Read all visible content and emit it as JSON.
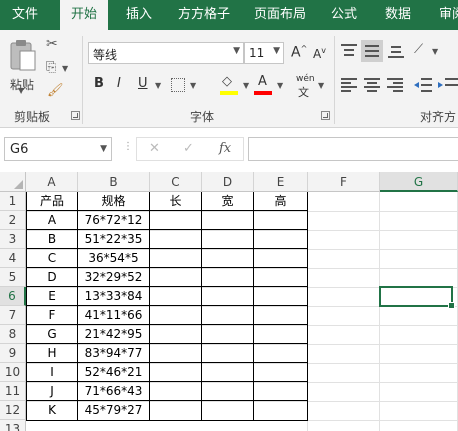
{
  "ribbon_tabs": [
    "文件",
    "开始",
    "插入",
    "方方格子",
    "页面布局",
    "公式",
    "数据",
    "审阅"
  ],
  "active_tab": "开始",
  "clipboard": {
    "paste_label": "粘贴",
    "group_label": "剪贴板"
  },
  "font": {
    "name": "等线",
    "size": "11",
    "group_label": "字体",
    "bold": "B",
    "italic": "I",
    "underline": "U",
    "grow": "A",
    "shrink": "A",
    "phonetic": "wén",
    "font_color_letter": "A",
    "highlight_color": "#ffff00",
    "font_color": "#ff0000"
  },
  "alignment": {
    "group_label": "对齐方"
  },
  "formula_bar": {
    "name_box": "G6",
    "cancel": "✕",
    "enter": "✓",
    "fx": "fx",
    "formula": ""
  },
  "columns": [
    "A",
    "B",
    "C",
    "D",
    "E",
    "F",
    "G"
  ],
  "rows": [
    "1",
    "2",
    "3",
    "4",
    "5",
    "6",
    "7",
    "8",
    "9",
    "10",
    "11",
    "12",
    "13"
  ],
  "selected_cell": "G6",
  "table": {
    "header": [
      "产品",
      "规格",
      "长",
      "宽",
      "高"
    ],
    "rows": [
      [
        "A",
        "76*72*12"
      ],
      [
        "B",
        "51*22*35"
      ],
      [
        "C",
        "36*54*5"
      ],
      [
        "D",
        "32*29*52"
      ],
      [
        "E",
        "13*33*84"
      ],
      [
        "F",
        "41*11*66"
      ],
      [
        "G",
        "21*42*95"
      ],
      [
        "H",
        "83*94*77"
      ],
      [
        "I",
        "52*46*21"
      ],
      [
        "J",
        "71*66*43"
      ],
      [
        "K",
        "45*79*27"
      ]
    ]
  },
  "colors": {
    "accent": "#217346",
    "ribbon_bg": "#f3f3f3"
  }
}
